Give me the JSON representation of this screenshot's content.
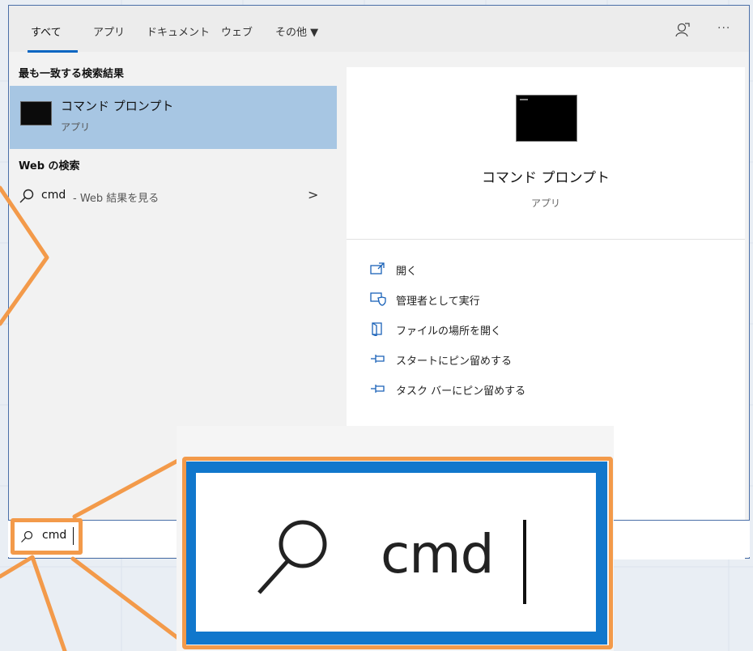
{
  "tabs": {
    "all": "すべて",
    "apps": "アプリ",
    "documents": "ドキュメント",
    "web": "ウェブ",
    "more": "その他 ▼"
  },
  "more_icon": "···",
  "sections": {
    "best_match": "最も一致する検索結果",
    "web_search": "Web の検索"
  },
  "best_match": {
    "title": "コマンド プロンプト",
    "subtitle": "アプリ"
  },
  "web_result": {
    "query": "cmd",
    "suffix": "- Web 結果を見る",
    "chevron": ">"
  },
  "detail": {
    "title": "コマンド プロンプト",
    "subtitle": "アプリ",
    "actions": [
      {
        "label": "開く",
        "icon": "open-icon"
      },
      {
        "label": "管理者として実行",
        "icon": "run-as-admin-icon"
      },
      {
        "label": "ファイルの場所を開く",
        "icon": "open-file-location-icon"
      },
      {
        "label": "スタートにピン留めする",
        "icon": "pin-icon"
      },
      {
        "label": "タスク バーにピン留めする",
        "icon": "pin-icon"
      }
    ]
  },
  "search": {
    "value": "cmd"
  },
  "zoom": {
    "value": "cmd"
  },
  "colors": {
    "accent": "#0a66c2",
    "highlight_row": "#a7c6e3",
    "annotation": "#f39a4a"
  }
}
